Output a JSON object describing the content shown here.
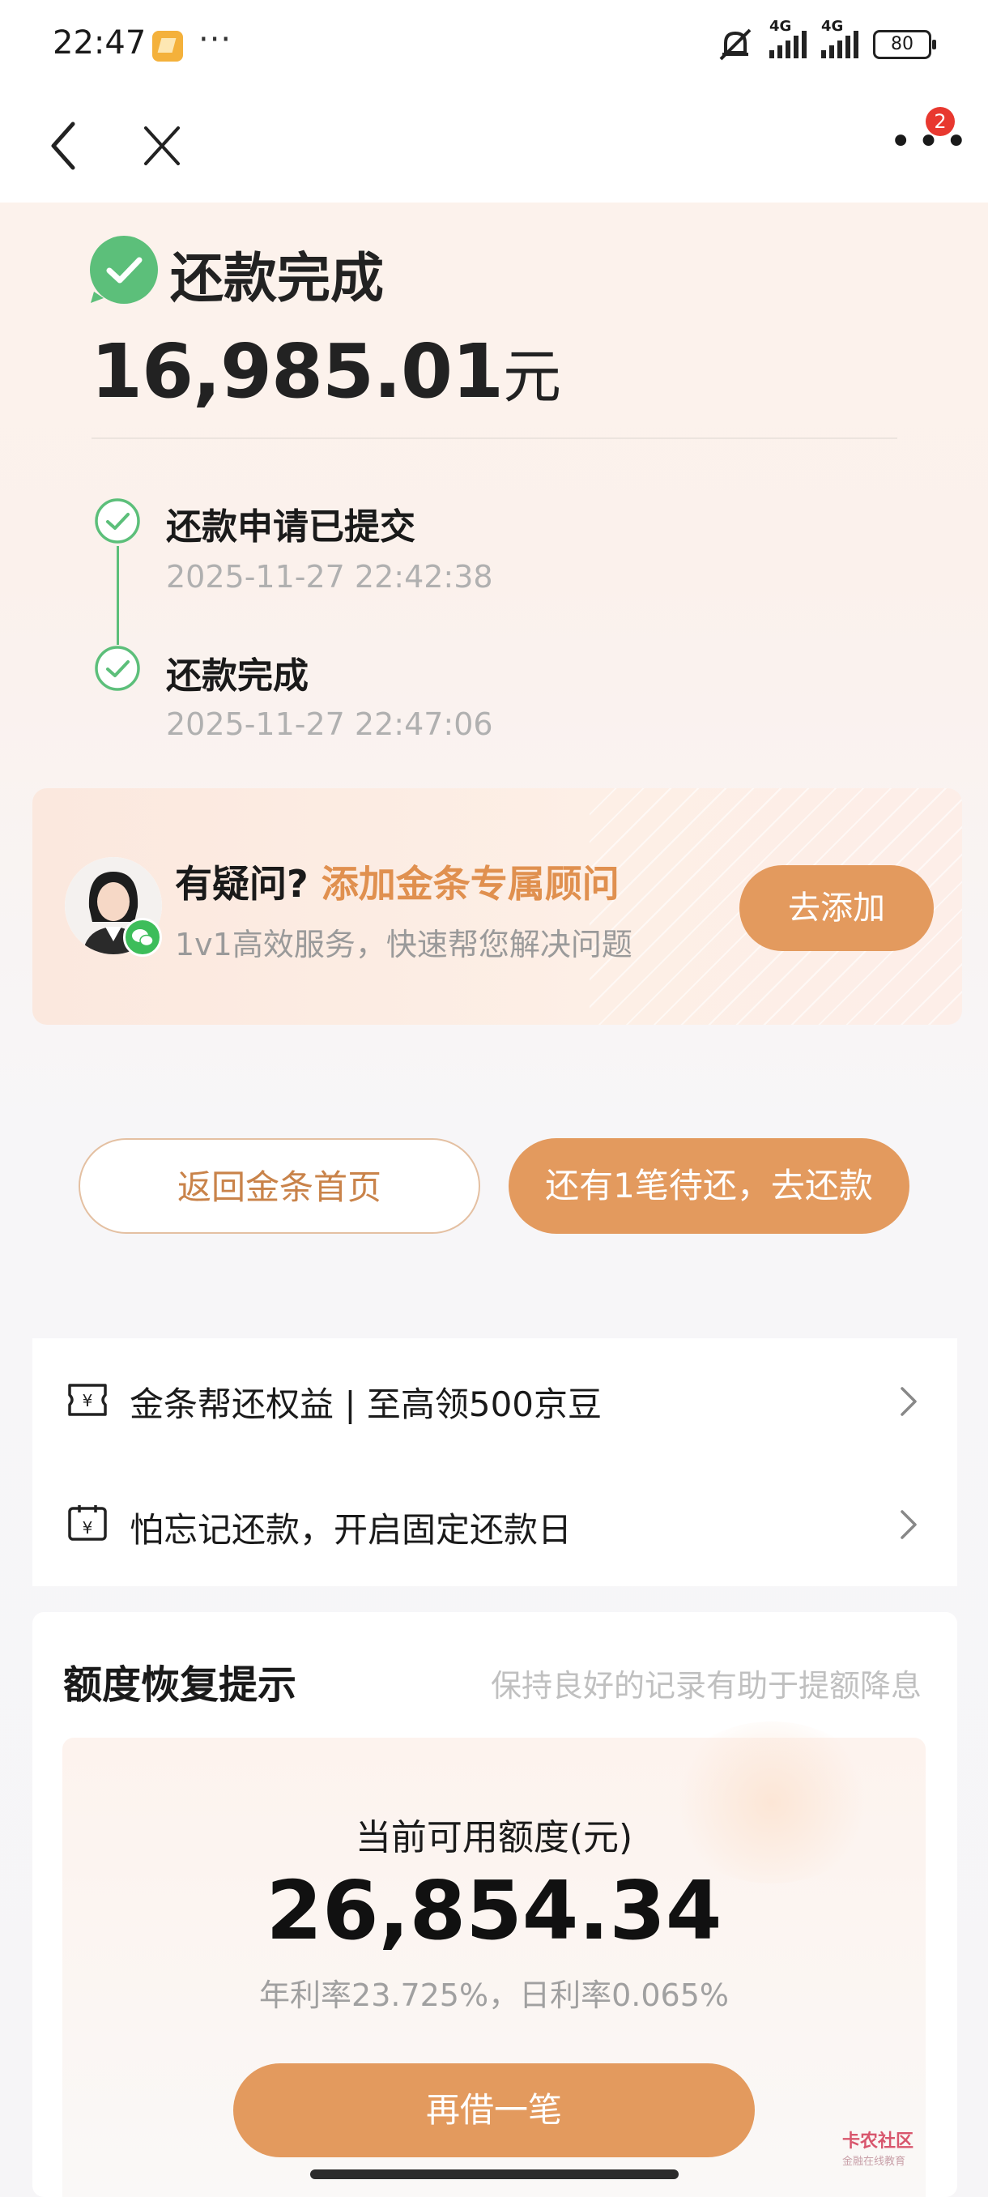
{
  "status_bar": {
    "time": "22:47",
    "more": "···",
    "network_1": "4G",
    "network_2": "4G",
    "battery": "80"
  },
  "nav": {
    "badge_count": "2"
  },
  "result": {
    "title": "还款完成",
    "amount": "16,985.01",
    "unit": "元"
  },
  "timeline": [
    {
      "label": "还款申请已提交",
      "time": "2025-11-27 22:42:38"
    },
    {
      "label": "还款完成",
      "time": "2025-11-27 22:47:06"
    }
  ],
  "advisor": {
    "question": "有疑问?",
    "highlight": "添加金条专属顾问",
    "subtitle": "1v1高效服务，快速帮您解决问题",
    "button": "去添加"
  },
  "actions": {
    "home": "返回金条首页",
    "repay": "还有1笔待还，去还款"
  },
  "list": [
    {
      "text": "金条帮还权益 | 至高领500京豆",
      "icon": "ticket-icon"
    },
    {
      "text": "怕忘记还款，开启固定还款日",
      "icon": "calendar-icon"
    }
  ],
  "quota": {
    "title": "额度恢复提示",
    "hint": "保持良好的记录有助于提额降息",
    "label": "当前可用额度(元)",
    "amount": "26,854.34",
    "rate": "年利率23.725%，日利率0.065%",
    "button": "再借一笔"
  },
  "watermark": {
    "name": "卡农社区",
    "sub": "金融在线教育"
  },
  "colors": {
    "accent": "#e39a5e",
    "success": "#5cbf7a",
    "badge": "#e8382f"
  }
}
